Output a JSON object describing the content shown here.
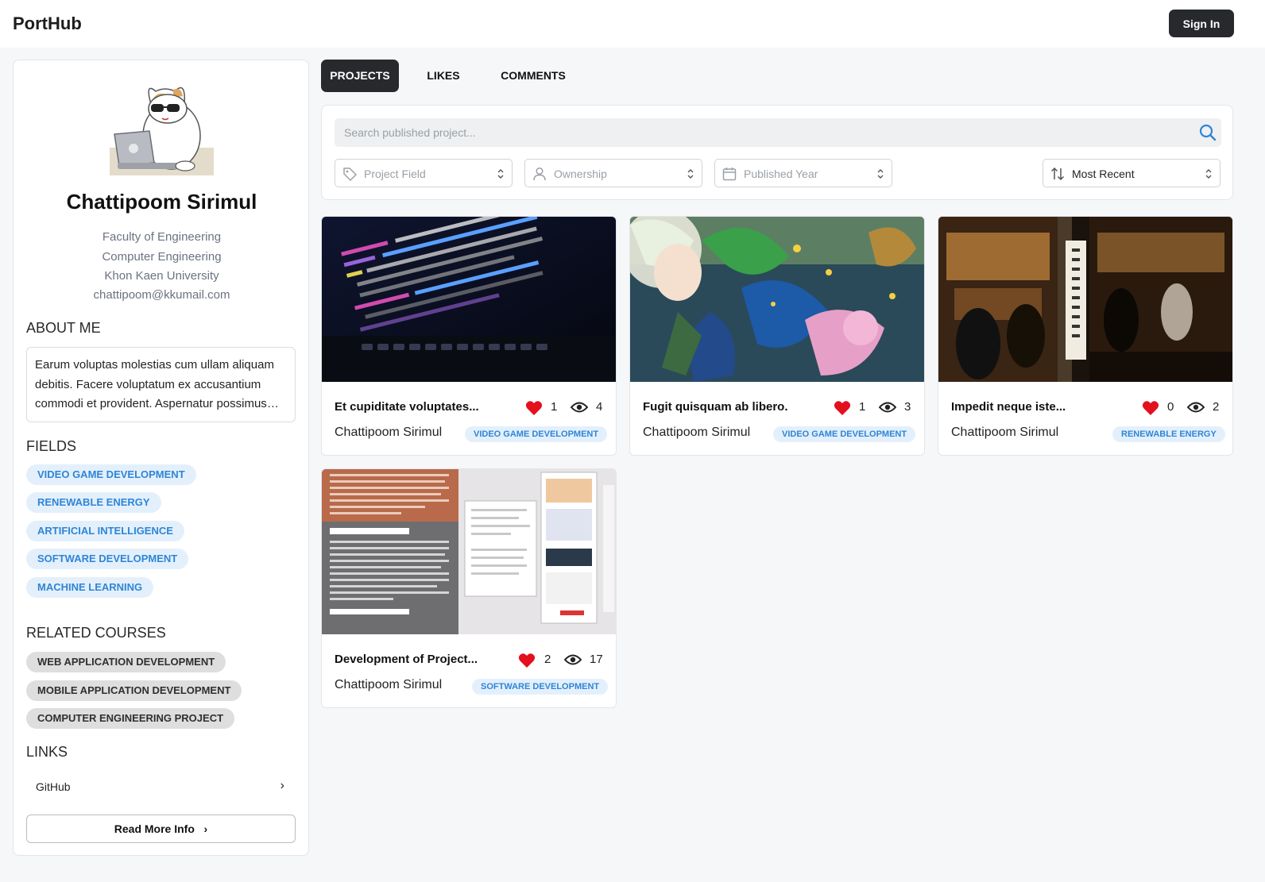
{
  "app": {
    "brand": "PortHub",
    "sign_in": "Sign In"
  },
  "profile": {
    "name": "Chattipoom Sirimul",
    "faculty": "Faculty of Engineering",
    "department": "Computer Engineering",
    "university": "Khon Kaen University",
    "email": "chattipoom@kkumail.com",
    "about_heading": "ABOUT ME",
    "about_text": "Earum voluptas molestias cum ullam aliquam debitis. Facere voluptatum ex accusantium commodi et provident. Asperna­tur possimus quia dolorem.",
    "fields_heading": "FIELDS",
    "fields": [
      "VIDEO GAME DEVELOPMENT",
      "RENEWABLE ENERGY",
      "ARTIFICIAL INTELLIGENCE",
      "SOFTWARE DEVELOPMENT",
      "MACHINE LEARNING"
    ],
    "courses_heading": "RELATED COURSES",
    "courses": [
      "WEB APPLICATION DEVELOPMENT",
      "MOBILE APPLICATION DEVELOPMENT",
      "COMPUTER ENGINEERING PROJECT"
    ],
    "links_heading": "LINKS",
    "links": [
      {
        "label": "GitHub"
      }
    ],
    "read_more": "Read More Info"
  },
  "tabs": [
    {
      "label": "PROJECTS",
      "active": true
    },
    {
      "label": "LIKES",
      "active": false
    },
    {
      "label": "COMMENTS",
      "active": false
    }
  ],
  "search": {
    "placeholder": "Search published project..."
  },
  "filters": {
    "field": "Project Field",
    "ownership": "Ownership",
    "year": "Published Year",
    "sort": "Most Recent"
  },
  "projects": [
    {
      "title": "Et cupiditate voluptates...",
      "likes": "1",
      "views": "4",
      "author": "Chattipoom Sirimul",
      "tag": "VIDEO GAME DEVELOPMENT",
      "image": "code-on-laptop"
    },
    {
      "title": "Fugit quisquam ab libero.",
      "likes": "1",
      "views": "3",
      "author": "Chattipoom Sirimul",
      "tag": "VIDEO GAME DEVELOPMENT",
      "image": "anime-illustration"
    },
    {
      "title": "Impedit neque iste...",
      "likes": "0",
      "views": "2",
      "author": "Chattipoom Sirimul",
      "tag": "RENEWABLE ENERGY",
      "image": "japanese-street-shop"
    },
    {
      "title": "Development of Project...",
      "likes": "2",
      "views": "17",
      "author": "Chattipoom Sirimul",
      "tag": "SOFTWARE DEVELOPMENT",
      "image": "project-poster"
    }
  ],
  "colors": {
    "accent": "#2f85d6",
    "dark": "#27292c",
    "heart": "#e3101e"
  }
}
